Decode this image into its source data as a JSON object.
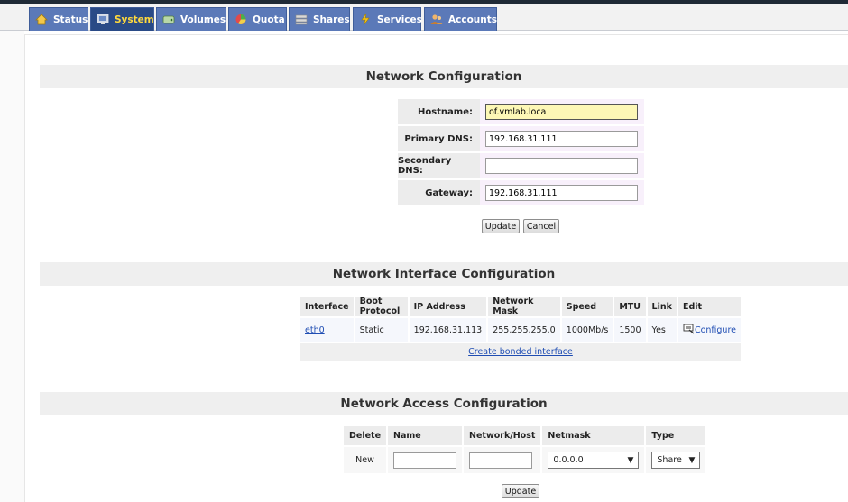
{
  "nav": {
    "tabs": [
      {
        "label": "Status",
        "icon": "status-icon"
      },
      {
        "label": "System",
        "icon": "system-icon",
        "active": true
      },
      {
        "label": "Volumes",
        "icon": "volumes-icon"
      },
      {
        "label": "Quota",
        "icon": "quota-icon"
      },
      {
        "label": "Shares",
        "icon": "shares-icon"
      },
      {
        "label": "Services",
        "icon": "services-icon"
      },
      {
        "label": "Accounts",
        "icon": "accounts-icon"
      }
    ]
  },
  "network_config": {
    "title": "Network Configuration",
    "hostname_label": "Hostname:",
    "hostname_value": "of.vmlab.loca",
    "primary_dns_label": "Primary DNS:",
    "primary_dns_value": "192.168.31.111",
    "secondary_dns_label": "Secondary DNS:",
    "secondary_dns_value": "",
    "gateway_label": "Gateway:",
    "gateway_value": "192.168.31.111",
    "update_label": "Update",
    "cancel_label": "Cancel"
  },
  "interface_config": {
    "title": "Network Interface Configuration",
    "columns": [
      "Interface",
      "Boot Protocol",
      "IP Address",
      "Network Mask",
      "Speed",
      "MTU",
      "Link",
      "Edit"
    ],
    "rows": [
      {
        "interface": "eth0",
        "boot_protocol": "Static",
        "ip": "192.168.31.113",
        "mask": "255.255.255.0",
        "speed": "1000Mb/s",
        "mtu": "1500",
        "link": "Yes",
        "edit": "Configure"
      }
    ],
    "bond_link": "Create bonded interface"
  },
  "access_config": {
    "title": "Network Access Configuration",
    "columns": [
      "Delete",
      "Name",
      "Network/Host",
      "Netmask",
      "Type"
    ],
    "new_label": "New",
    "name_value": "",
    "network_value": "",
    "netmask_selected": "0.0.0.0",
    "type_selected": "Share",
    "update_label": "Update"
  },
  "colors": {
    "tab_bg": "#5b79b8",
    "tab_active_bg": "#2a4a86",
    "tab_active_text": "#ffd93d",
    "link": "#1f4db3"
  }
}
